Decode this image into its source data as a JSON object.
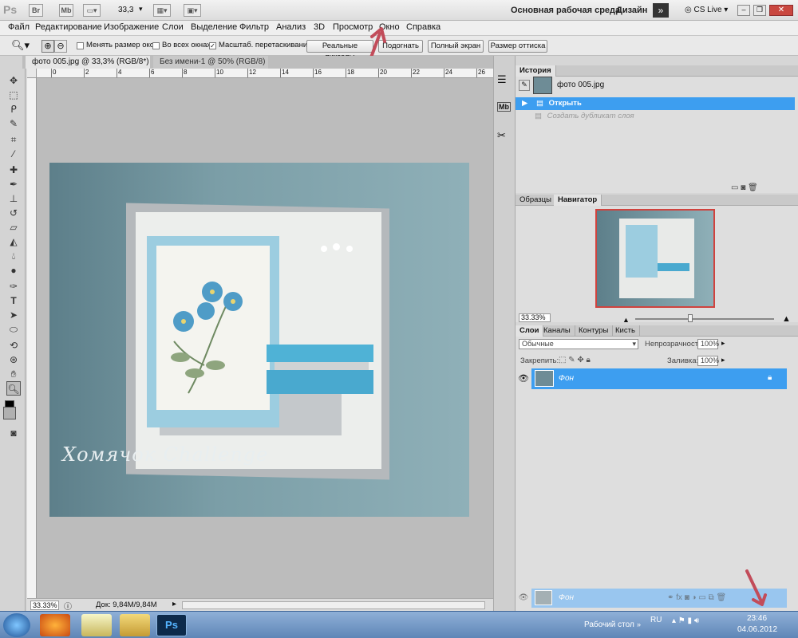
{
  "appbar": {
    "logo": "Ps",
    "btn_br": "Br",
    "btn_mb": "Mb",
    "zoom": "33,3",
    "workspace": "Основная рабочая среда",
    "design": "Дизайн",
    "cs_live": "CS Live"
  },
  "menu": [
    "Файл",
    "Редактирование",
    "Изображение",
    "Слои",
    "Выделение",
    "Фильтр",
    "Анализ",
    "3D",
    "Просмотр",
    "Окно",
    "Справка"
  ],
  "options": {
    "resize_windows": "Менять размер окон",
    "all_windows": "Во всех окнах",
    "scrubby_zoom": "Масштаб. перетаскиванием",
    "actual_pixels": "Реальные пикселы",
    "fit": "Подогнать",
    "full_screen": "Полный экран",
    "print_size": "Размер оттиска"
  },
  "tabs": {
    "doc1": "фото 005.jpg @ 33,3% (RGB/8*) *",
    "doc2": "Без имени-1 @ 50% (RGB/8) *"
  },
  "ruler_h": [
    "0",
    "2",
    "4",
    "6",
    "8",
    "10",
    "12",
    "14",
    "16",
    "18",
    "20",
    "22",
    "24",
    "26"
  ],
  "status": {
    "zoom": "33.33%",
    "doc": "Док: 9,84M/9,84M"
  },
  "watermark": "Хомячок Challenge",
  "history": {
    "tab": "История",
    "snapshot": "фото 005.jpg",
    "items": [
      "Открыть",
      "Создать дубликат слоя"
    ]
  },
  "navigator": {
    "tab_swatches": "Образцы",
    "tab_navigator": "Навигатор",
    "zoom": "33.33%"
  },
  "layers": {
    "tabs": [
      "Слои",
      "Каналы",
      "Контуры",
      "Кисть"
    ],
    "blend_mode": "Обычные",
    "opacity_label": "Непрозрачность:",
    "opacity": "100%",
    "lock_label": "Закрепить:",
    "fill_label": "Заливка:",
    "fill": "100%",
    "layer_name": "Фон",
    "drag_layer_name": "Фон"
  },
  "taskbar": {
    "desktop": "Рабочий стол",
    "lang": "RU",
    "time": "23:46",
    "date": "04.06.2012"
  },
  "colors": {
    "selection_blue": "#3d9ef0",
    "accent_arrow": "#c24c5a"
  }
}
